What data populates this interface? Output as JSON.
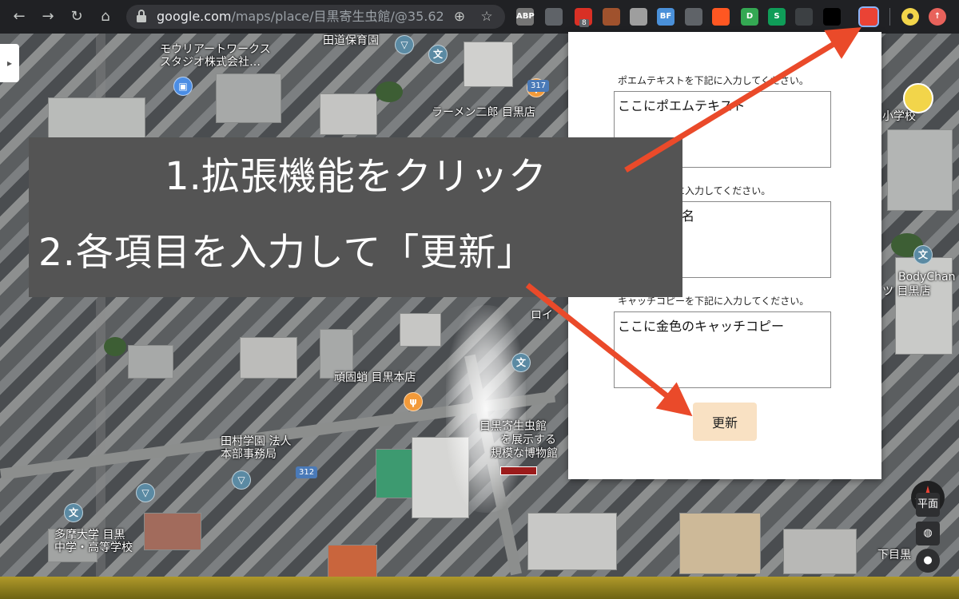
{
  "browser": {
    "url_host": "google.com",
    "url_rest": "/maps/place/目黒寄生虫館/@35.6294...",
    "extensions": [
      {
        "name": "adblock-extension",
        "text": "ABP",
        "color": "#757575"
      },
      {
        "name": "camera-extension",
        "text": "",
        "color": "#5f6368"
      },
      {
        "name": "red-dots-extension",
        "text": "",
        "color": "#d93025",
        "badge": "8"
      },
      {
        "name": "cookie-extension",
        "text": "",
        "color": "#a0522d"
      },
      {
        "name": "eraser-extension",
        "text": "",
        "color": "#9e9e9e"
      },
      {
        "name": "bf-extension",
        "text": "BF",
        "color": "#4a90d9"
      },
      {
        "name": "bolt-extension",
        "text": "",
        "color": "#5f6368"
      },
      {
        "name": "fire-extension",
        "text": "",
        "color": "#ff5722"
      },
      {
        "name": "d-extension",
        "text": "D",
        "color": "#34a853"
      },
      {
        "name": "s-extension",
        "text": "S",
        "color": "#0f9d58"
      },
      {
        "name": "qr-extension",
        "text": "",
        "color": "#3c4043"
      },
      {
        "name": "save-extension",
        "text": "",
        "color": "#000000"
      },
      {
        "name": "poem-extension",
        "text": "",
        "color": "#ea4335"
      }
    ]
  },
  "map": {
    "labels": {
      "morii": "モウリアートワークス\nスタジオ株式会社…",
      "denmichi": "田道保育園",
      "ramen": "ラーメン二郎 目黒店",
      "school": "小学校",
      "bodychan": "BodyChan",
      "tsu_meguro": "ツ 目黒店",
      "roi": "ロイ",
      "ganko": "頑固蛸 目黒本店",
      "kiseichu": "目黒寄生虫館",
      "kiseichu_sub1": "を展示する",
      "kiseichu_sub2": "規模な博物館",
      "tamura": "田村学園 法人\n本部事務局",
      "tama": "多摩大学 目黒\n中学・高等学校",
      "shimomeguro": "下目黒",
      "route_312": "312",
      "route_317": "317"
    },
    "controls": {
      "flat": "平面"
    }
  },
  "popup": {
    "poem_label": "ポエムテキストを下記に入力してください。",
    "poem_value": "ここにポエムテキスト",
    "property_label": "物件名を下記に入力してください。",
    "property_value": "ここに物件名",
    "catch_label": "キャッチコピーを下記に入力してください。",
    "catch_value": "ここに金色のキャッチコピー",
    "update_label": "更新"
  },
  "overlay": {
    "step1": "1.拡張機能をクリック",
    "step2": "2.各項目を入力して「更新」"
  },
  "colors": {
    "arrow": "#ea4a2a",
    "banner": "#545454",
    "update_button": "#f9e1c3"
  }
}
